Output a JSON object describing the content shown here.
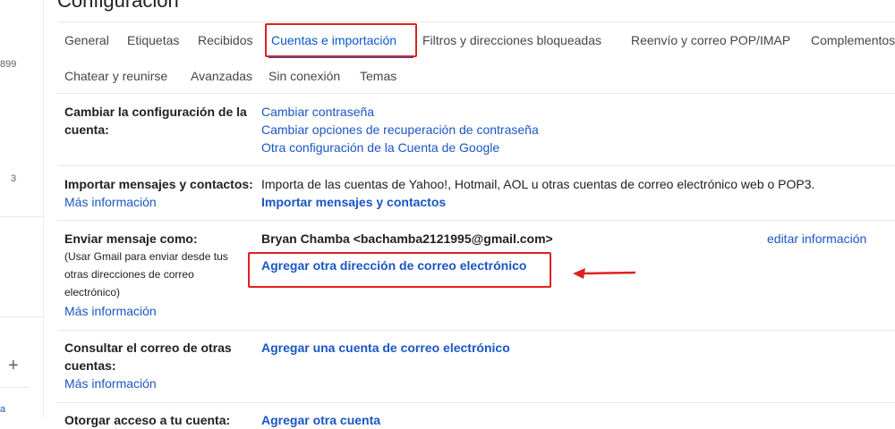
{
  "page": {
    "title": "Configuración"
  },
  "left_rail": {
    "count_1": "899",
    "count_2": "3",
    "add_label": "+",
    "link_fragment": "a"
  },
  "tabs": {
    "general": "General",
    "etiquetas": "Etiquetas",
    "recibidos": "Recibidos",
    "cuentas": "Cuentas e importación",
    "filtros": "Filtros y direcciones bloqueadas",
    "reenvio": "Reenvío y correo POP/IMAP",
    "complementos": "Complementos",
    "chatear": "Chatear y reunirse",
    "avanzadas": "Avanzadas",
    "sin_conexion": "Sin conexión",
    "temas": "Temas"
  },
  "sections": {
    "cambiar": {
      "label_line1": "Cambiar la configuración de la",
      "label_line2": "cuenta:",
      "link_password": "Cambiar contraseña",
      "link_recovery": "Cambiar opciones de recuperación de contraseña",
      "link_google": "Otra configuración de la Cuenta de Google"
    },
    "importar": {
      "label": "Importar mensajes y contactos:",
      "more": "Más información",
      "description": "Importa de las cuentas de Yahoo!, Hotmail, AOL u otras cuentas de correo electrónico web o POP3.",
      "action": "Importar mensajes y contactos"
    },
    "enviar": {
      "label": "Enviar mensaje como:",
      "sub_line1": "(Usar Gmail para enviar desde tus",
      "sub_line2": "otras direcciones de correo",
      "sub_line3": "electrónico)",
      "more": "Más información",
      "identity": "Bryan Chamba <bachamba2121995@gmail.com>",
      "edit": "editar información",
      "add_address": "Agregar otra dirección de correo electrónico"
    },
    "consultar": {
      "label_line1": "Consultar el correo de otras",
      "label_line2": "cuentas:",
      "more": "Más información",
      "action": "Agregar una cuenta de correo electrónico"
    },
    "otorgar": {
      "label": "Otorgar acceso a tu cuenta:",
      "action": "Agregar otra cuenta"
    }
  },
  "annotation": {
    "color": "#e02020"
  }
}
